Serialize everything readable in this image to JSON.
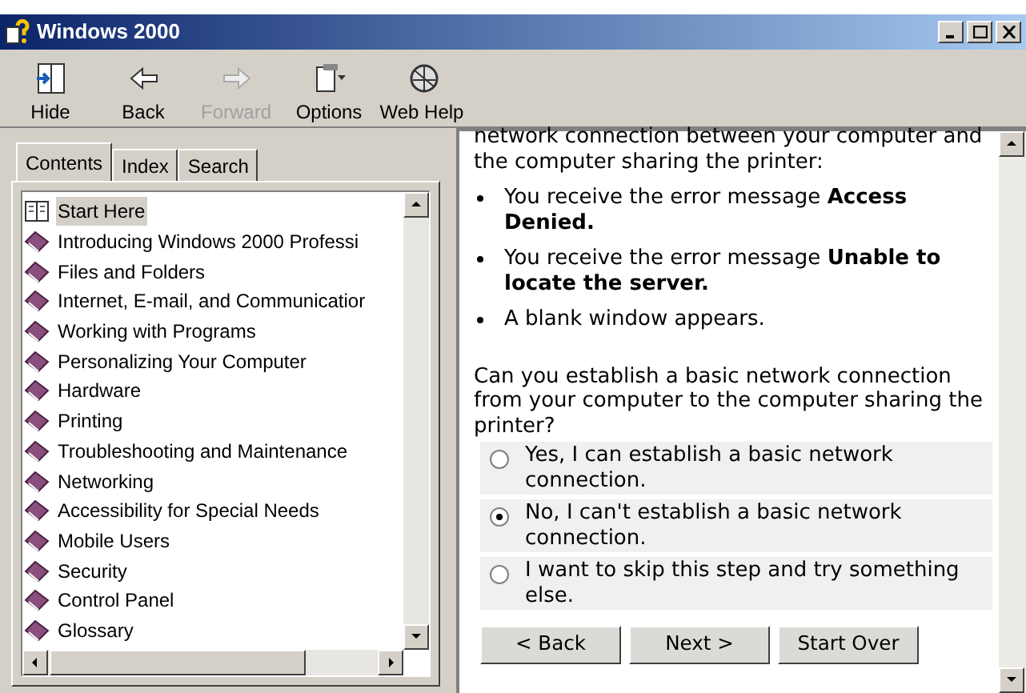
{
  "window": {
    "title": "Windows 2000"
  },
  "toolbar": [
    {
      "label": "Hide",
      "disabled": false
    },
    {
      "label": "Back",
      "disabled": false
    },
    {
      "label": "Forward",
      "disabled": true
    },
    {
      "label": "Options",
      "disabled": false
    },
    {
      "label": "Web Help",
      "disabled": false
    }
  ],
  "tabs": [
    {
      "label": "Contents",
      "selected": true
    },
    {
      "label": "Index",
      "selected": false
    },
    {
      "label": "Search",
      "selected": false
    }
  ],
  "tree": [
    {
      "label": "Start Here",
      "kind": "page",
      "selected": true
    },
    {
      "label": "Introducing Windows 2000 Professi",
      "kind": "book",
      "selected": false
    },
    {
      "label": "Files and Folders",
      "kind": "book",
      "selected": false
    },
    {
      "label": "Internet, E-mail, and Communicatior",
      "kind": "book",
      "selected": false
    },
    {
      "label": "Working with Programs",
      "kind": "book",
      "selected": false
    },
    {
      "label": "Personalizing Your Computer",
      "kind": "book",
      "selected": false
    },
    {
      "label": "Hardware",
      "kind": "book",
      "selected": false
    },
    {
      "label": "Printing",
      "kind": "book",
      "selected": false
    },
    {
      "label": "Troubleshooting and Maintenance",
      "kind": "book",
      "selected": false
    },
    {
      "label": "Networking",
      "kind": "book",
      "selected": false
    },
    {
      "label": "Accessibility for Special Needs",
      "kind": "book",
      "selected": false
    },
    {
      "label": "Mobile Users",
      "kind": "book",
      "selected": false
    },
    {
      "label": "Security",
      "kind": "book",
      "selected": false
    },
    {
      "label": "Control Panel",
      "kind": "book",
      "selected": false
    },
    {
      "label": "Glossary",
      "kind": "book",
      "selected": false
    }
  ],
  "content": {
    "intro": "network connection between your computer and the computer sharing the printer:",
    "bullets": [
      "You receive the error message **Access Denied.**",
      "You receive the error message **Unable to locate the server.**",
      "A blank window appears."
    ],
    "question": "Can you establish a basic network connection from your computer to the computer sharing the printer?",
    "options": [
      {
        "label": "Yes, I can establish a basic network connection.",
        "selected": false
      },
      {
        "label": "No, I can't establish a basic network connection.",
        "selected": true
      },
      {
        "label": "I want to skip this step and try something else.",
        "selected": false
      }
    ],
    "buttons": [
      "< Back",
      "Next >",
      "Start Over"
    ]
  }
}
